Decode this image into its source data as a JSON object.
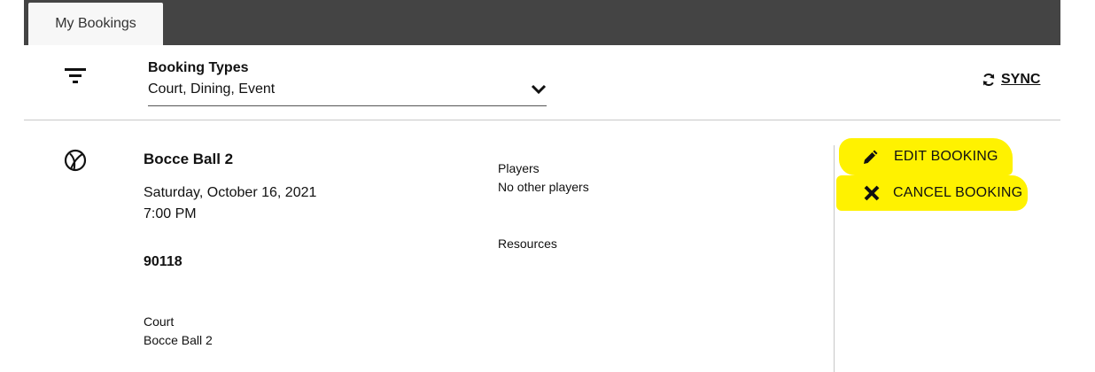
{
  "tabs": [
    {
      "label": "My Bookings",
      "active": true
    }
  ],
  "filter": {
    "icon": "filter-list-icon",
    "title": "Booking Types",
    "value": "Court, Dining, Event"
  },
  "sync": {
    "label": "SYNC",
    "icon": "sync-icon"
  },
  "booking": {
    "icon": "ball-icon",
    "name": "Bocce Ball 2",
    "date": "Saturday, October 16, 2021",
    "time": "7:00 PM",
    "number": "90118",
    "type": "Court",
    "facility": "Bocce Ball 2",
    "players_title": "Players",
    "players_value": "No other players",
    "resources_title": "Resources"
  },
  "actions": {
    "edit": {
      "label": "EDIT BOOKING",
      "icon": "pencil-icon"
    },
    "cancel": {
      "label": "CANCEL BOOKING",
      "icon": "close-icon"
    }
  },
  "colors": {
    "tabbar": "#444444",
    "highlight": "#fff200"
  }
}
